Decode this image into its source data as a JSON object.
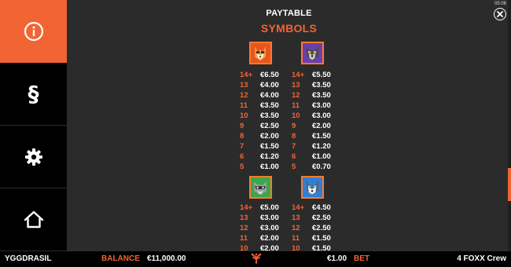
{
  "sidebar": {
    "items": [
      {
        "name": "info",
        "active": true
      },
      {
        "name": "rules",
        "glyph": "§"
      },
      {
        "name": "settings"
      },
      {
        "name": "home"
      }
    ]
  },
  "header": {
    "title": "PAYTABLE",
    "subtitle": "SYMBOLS",
    "clock": "05:06"
  },
  "symbols": [
    {
      "icon": "fox-symbol",
      "payouts": [
        {
          "count": "14+",
          "amount": "€6.50"
        },
        {
          "count": "13",
          "amount": "€4.00"
        },
        {
          "count": "12",
          "amount": "€4.00"
        },
        {
          "count": "11",
          "amount": "€3.50"
        },
        {
          "count": "10",
          "amount": "€3.50"
        },
        {
          "count": "9",
          "amount": "€2.50"
        },
        {
          "count": "8",
          "amount": "€2.00"
        },
        {
          "count": "7",
          "amount": "€1.50"
        },
        {
          "count": "6",
          "amount": "€1.20"
        },
        {
          "count": "5",
          "amount": "€1.00"
        }
      ]
    },
    {
      "icon": "wolf-symbol",
      "payouts": [
        {
          "count": "14+",
          "amount": "€5.50"
        },
        {
          "count": "13",
          "amount": "€3.50"
        },
        {
          "count": "12",
          "amount": "€3.50"
        },
        {
          "count": "11",
          "amount": "€3.00"
        },
        {
          "count": "10",
          "amount": "€3.00"
        },
        {
          "count": "9",
          "amount": "€2.00"
        },
        {
          "count": "8",
          "amount": "€1.50"
        },
        {
          "count": "7",
          "amount": "€1.20"
        },
        {
          "count": "6",
          "amount": "€1.00"
        },
        {
          "count": "5",
          "amount": "€0.70"
        }
      ]
    },
    {
      "icon": "raccoon-symbol",
      "payouts": [
        {
          "count": "14+",
          "amount": "€5.00"
        },
        {
          "count": "13",
          "amount": "€3.00"
        },
        {
          "count": "12",
          "amount": "€3.00"
        },
        {
          "count": "11",
          "amount": "€2.00"
        },
        {
          "count": "10",
          "amount": "€2.00"
        }
      ]
    },
    {
      "icon": "husky-symbol",
      "payouts": [
        {
          "count": "14+",
          "amount": "€4.50"
        },
        {
          "count": "13",
          "amount": "€2.50"
        },
        {
          "count": "12",
          "amount": "€2.50"
        },
        {
          "count": "11",
          "amount": "€1.50"
        },
        {
          "count": "10",
          "amount": "€1.50"
        }
      ]
    }
  ],
  "footer": {
    "brand": "YGGDRASIL",
    "balance_label": "BALANCE",
    "balance_value": "€11,000.00",
    "bet_value": "€1.00",
    "bet_label": "BET",
    "game_name": "4 FOXX Crew"
  },
  "colors": {
    "accent": "#f26433",
    "panel": "#2b2b2b",
    "sidebar": "#000000"
  }
}
